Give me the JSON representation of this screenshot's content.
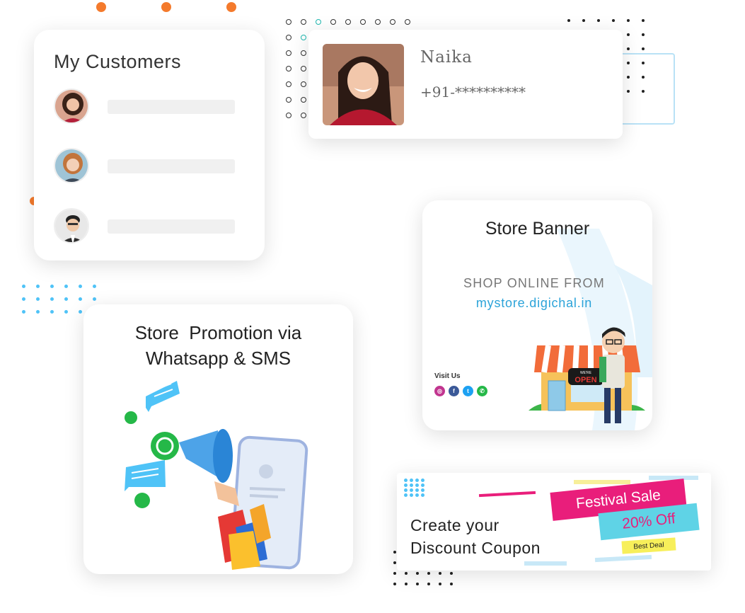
{
  "customers": {
    "title": "My Customers"
  },
  "contact": {
    "name": "Naika",
    "phone": "+91-**********"
  },
  "banner": {
    "title": "Store Banner",
    "shop_text": "SHOP ONLINE FROM",
    "url": "mystore.digichal.in",
    "visit_label": "Visit Us",
    "sign_top": "WE'RE",
    "sign_text": "OPEN",
    "socials": [
      "instagram-icon",
      "facebook-icon",
      "twitter-icon",
      "whatsapp-icon"
    ]
  },
  "promo": {
    "title": "Store  Promotion via\nWhatsapp & SMS"
  },
  "coupon": {
    "text_line1": "Create your",
    "text_line2": "Discount Coupon",
    "sale_label": "Festival Sale",
    "discount_label": "20% Off",
    "deal_label": "Best Deal"
  },
  "colors": {
    "accent_orange": "#f47a2c",
    "link_blue": "#2ba3d9",
    "whatsapp_green": "#25b848",
    "sale_pink": "#e91e7b",
    "discount_cyan": "#5fd3e6"
  }
}
